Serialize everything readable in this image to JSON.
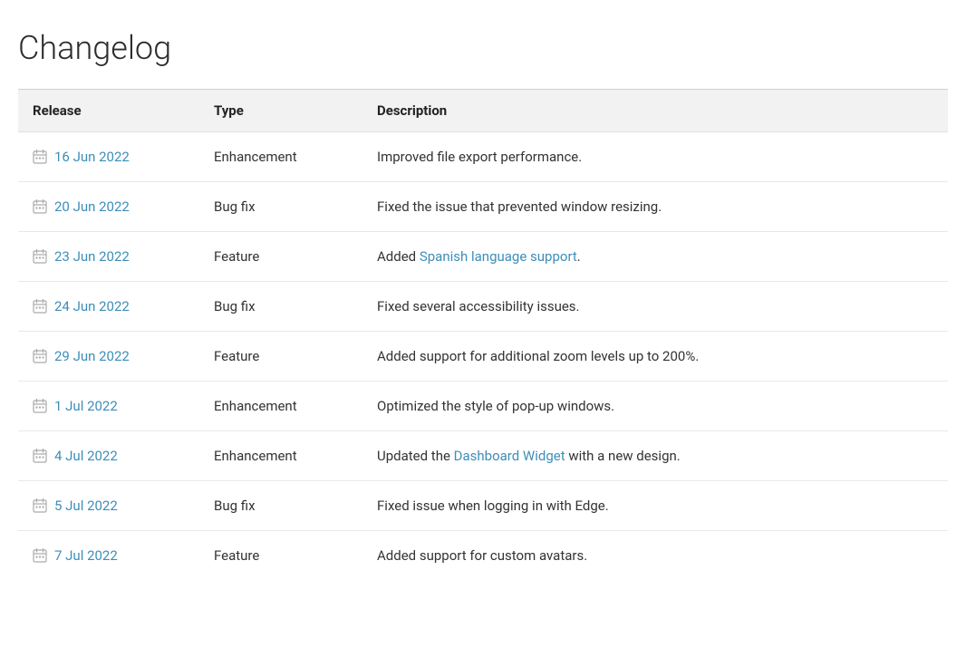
{
  "page": {
    "title": "Changelog"
  },
  "table": {
    "headers": {
      "release": "Release",
      "type": "Type",
      "description": "Description"
    },
    "rows": [
      {
        "id": 1,
        "date": "16 Jun 2022",
        "type": "Enhancement",
        "description_plain": "Improved file export performance.",
        "description_parts": [
          {
            "text": "Improved file export performance.",
            "link": false
          }
        ]
      },
      {
        "id": 2,
        "date": "20 Jun 2022",
        "type": "Bug fix",
        "description_plain": "Fixed the issue that prevented window resizing.",
        "description_parts": [
          {
            "text": "Fixed the issue that prevented window resizing.",
            "link": false
          }
        ]
      },
      {
        "id": 3,
        "date": "23 Jun 2022",
        "type": "Feature",
        "description_plain": "Added Spanish language support.",
        "description_parts": [
          {
            "text": "Added ",
            "link": false
          },
          {
            "text": "Spanish language support",
            "link": true
          },
          {
            "text": ".",
            "link": false
          }
        ]
      },
      {
        "id": 4,
        "date": "24 Jun 2022",
        "type": "Bug fix",
        "description_plain": "Fixed several accessibility issues.",
        "description_parts": [
          {
            "text": "Fixed several accessibility issues.",
            "link": false
          }
        ]
      },
      {
        "id": 5,
        "date": "29 Jun 2022",
        "type": "Feature",
        "description_plain": "Added support for additional zoom levels up to 200%.",
        "description_parts": [
          {
            "text": "Added support for additional zoom levels up to 200%.",
            "link": false
          }
        ]
      },
      {
        "id": 6,
        "date": "1 Jul 2022",
        "type": "Enhancement",
        "description_plain": "Optimized the style of pop-up windows.",
        "description_parts": [
          {
            "text": "Optimized the style of pop-up windows.",
            "link": false
          }
        ]
      },
      {
        "id": 7,
        "date": "4 Jul 2022",
        "type": "Enhancement",
        "description_plain": "Updated the Dashboard Widget with a new design.",
        "description_parts": [
          {
            "text": "Updated the ",
            "link": false
          },
          {
            "text": "Dashboard Widget",
            "link": true
          },
          {
            "text": " with a new design.",
            "link": false
          }
        ]
      },
      {
        "id": 8,
        "date": "5 Jul 2022",
        "type": "Bug fix",
        "description_plain": "Fixed issue when logging in with Edge.",
        "description_parts": [
          {
            "text": "Fixed issue when logging in with Edge.",
            "link": false
          }
        ]
      },
      {
        "id": 9,
        "date": "7 Jul 2022",
        "type": "Feature",
        "description_plain": "Added support for custom avatars.",
        "description_parts": [
          {
            "text": "Added support for custom avatars.",
            "link": false
          }
        ]
      }
    ]
  }
}
